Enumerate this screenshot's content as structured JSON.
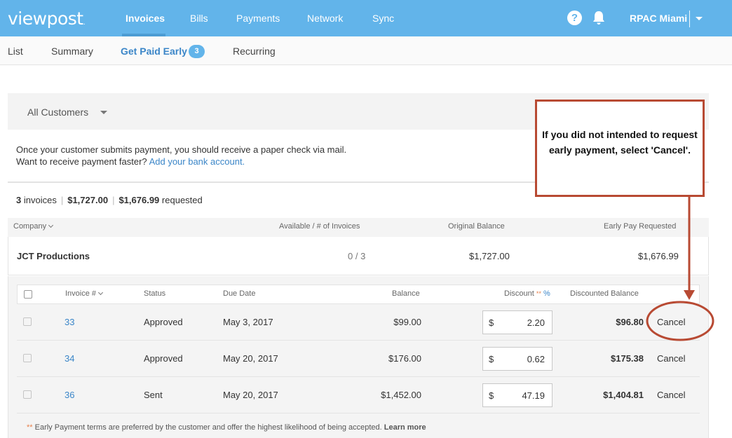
{
  "topnav": {
    "logo": "viewpost",
    "logo_mark": ".",
    "links": [
      "Invoices",
      "Bills",
      "Payments",
      "Network",
      "Sync"
    ],
    "help_label": "?",
    "account": "RPAC Miami"
  },
  "subnav": {
    "tabs": [
      "List",
      "Summary",
      "Get Paid Early",
      "Recurring"
    ],
    "badge": "3"
  },
  "filter": {
    "label": "All Customers"
  },
  "info": {
    "line1": "Once your customer submits payment, you should receive a paper check via mail.",
    "line2_prefix": "Want to receive payment faster?",
    "line2_link": "Add your bank account."
  },
  "summary": {
    "count": "3",
    "count_label": "invoices",
    "total": "$1,727.00",
    "requested": "$1,676.99",
    "requested_label": "requested"
  },
  "columns": {
    "company": "Company",
    "available": "Available / # of Invoices",
    "original": "Original Balance",
    "early": "Early Pay Requested"
  },
  "company": {
    "name": "JCT Productions",
    "available": "0 / 3",
    "original": "$1,727.00",
    "early": "$1,676.99"
  },
  "invoice_columns": {
    "invoice": "Invoice #",
    "status": "Status",
    "due": "Due Date",
    "balance": "Balance",
    "discount": "Discount",
    "discount_stars": "**",
    "discount_pct": "%",
    "discounted": "Discounted Balance"
  },
  "invoices": [
    {
      "number": "33",
      "status": "Approved",
      "due": "May 3, 2017",
      "balance": "$99.00",
      "currency": "$",
      "discount": "2.20",
      "discounted": "$96.80",
      "action": "Cancel"
    },
    {
      "number": "34",
      "status": "Approved",
      "due": "May 20, 2017",
      "balance": "$176.00",
      "currency": "$",
      "discount": "0.62",
      "discounted": "$175.38",
      "action": "Cancel"
    },
    {
      "number": "36",
      "status": "Sent",
      "due": "May 20, 2017",
      "balance": "$1,452.00",
      "currency": "$",
      "discount": "47.19",
      "discounted": "$1,404.81",
      "action": "Cancel"
    }
  ],
  "footnote": {
    "stars": "**",
    "text": "Early Payment terms are preferred by the customer and offer the highest likelihood of being accepted.",
    "link": "Learn more"
  },
  "callout": {
    "text": "If you did not intended to request early payment, select 'Cancel'.",
    "color": "#b84a33"
  },
  "colors": {
    "topbar": "#62b4ea",
    "link": "#3b86c8",
    "annotation": "#b84a33"
  }
}
